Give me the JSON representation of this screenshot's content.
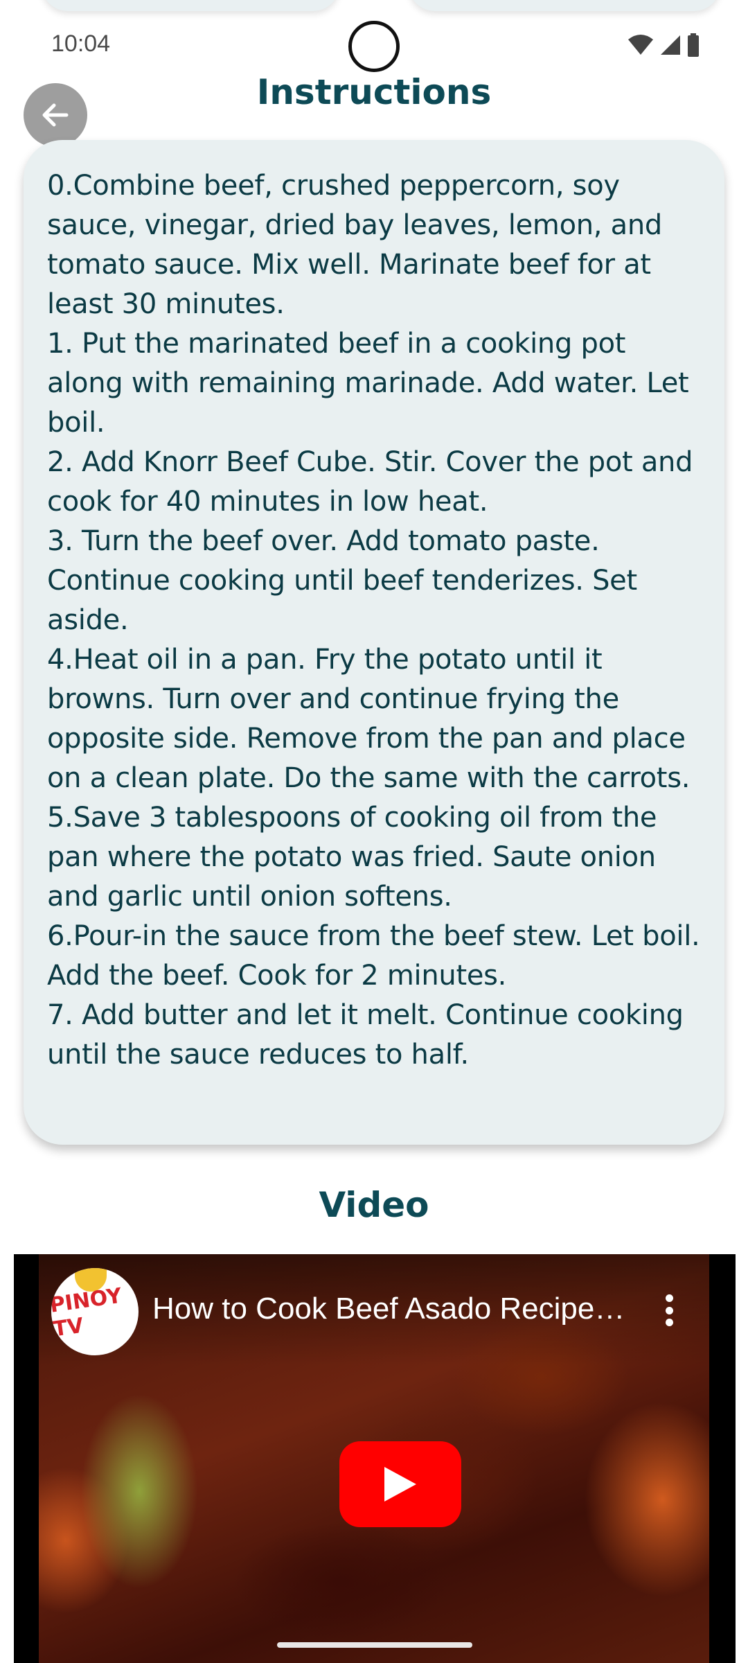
{
  "status_bar": {
    "time": "10:04"
  },
  "header": {
    "title": "Instructions"
  },
  "instructions": [
    "0.Combine beef, crushed peppercorn, soy sauce, vinegar, dried bay leaves, lemon, and tomato sauce. Mix well. Marinate beef for at least 30 minutes.",
    "1. Put the marinated beef in a cooking pot along with remaining marinade. Add water. Let boil.",
    "2. Add Knorr Beef Cube. Stir. Cover the pot and cook for 40 minutes in low heat.",
    "3. Turn the beef over. Add tomato paste. Continue cooking until beef tenderizes. Set aside.",
    "4.Heat oil in a pan. Fry the potato until it browns. Turn over and continue frying the opposite side. Remove from the pan and place on a clean plate. Do the same with the carrots.",
    "5.Save 3 tablespoons of cooking oil from the pan where the potato was fried. Saute onion and garlic until onion softens.",
    "6.Pour-in the sauce from the beef stew. Let boil. Add the beef. Cook for 2 minutes.",
    "7. Add butter and let it melt. Continue cooking until the sauce reduces to half."
  ],
  "video_section": {
    "title": "Video",
    "video_title": "How to Cook Beef Asado Recipe…",
    "channel_logo_text": "PINOY TV"
  },
  "colors": {
    "title": "#0d4a56",
    "card_bg": "#e9f0f1",
    "play": "#ff0000"
  }
}
